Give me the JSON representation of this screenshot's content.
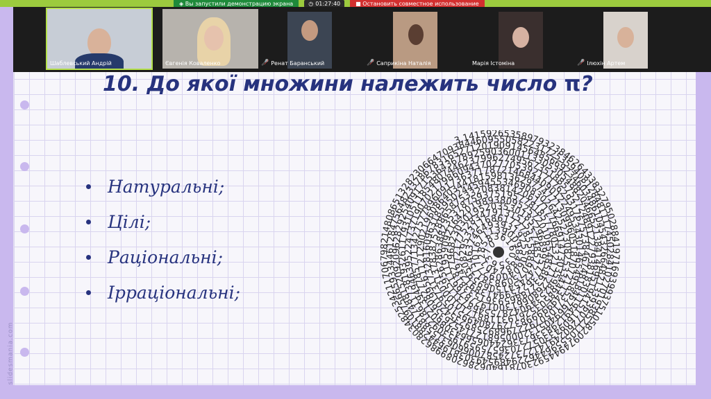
{
  "screen_share": {
    "status_text": "Вы запустили демонстрацию экрана",
    "timer": "01:27:40",
    "stop_label": "Остановить совместное использование"
  },
  "participants": [
    {
      "name": "Шаблевський Андрій",
      "muted": false,
      "active": true
    },
    {
      "name": "Євгенія Коваленко",
      "muted": false,
      "active": false
    },
    {
      "name": "Ренат Баранський",
      "muted": true,
      "active": false
    },
    {
      "name": "Саприкіна Наталія",
      "muted": true,
      "active": false
    },
    {
      "name": "Марія Істоміна",
      "muted": false,
      "active": false
    },
    {
      "name": "Ілюхін Артем",
      "muted": true,
      "active": false
    }
  ],
  "slide": {
    "title": "10. До якої множини належить число",
    "title_symbol": "π",
    "title_end": "?",
    "options": [
      "Натуральні;",
      "Цілі;",
      "Раціональні;",
      "Ірраціональні;"
    ],
    "watermark": "slidesmania.com",
    "pi_digits": "3,14159265358979323846264338327950288419716939937510582097494459230781640628620899862803482534211706798214808651328230664709384460955058223172535940812848111745028410270193852110555964462294895493038196442881097566593344612847564823378678316527120190914564856692346034861045432664821339360726024914127372458700660631558817488152092096282925409171536436789259036001133053054882046652138414695194151160943305727036575959195309218611738193261179310511854807446237996274956735188575272489122793818301194912983367336244065664308602139494639522473719070217986094370277053921717629317675238467481846766940513200056812714526356082778577134275778960917363717872146844090122495343014654958537105079227968925892354201995611212902196086403441815981362977477130996051870721134999999837297804995105973173281609631859502445945534690830264252230825334468503526193118817101000313783875288658753320838142061717766914730359825349042875546873115956286388235378759375195778185778053217122680661300192787661119590921642019893809525720106548586327886593615338182796823030195203530185296899577362259941389124972177528347913151557485724245415069595082953311686172785588907509838175463746493931925506040092770167113900984882401285836160356370766010471018194295559619894676783744944825537977472684710404753464620804668425906949129331367702898915210475216205696602405803815019351125338243003558764024749647326391419927260426992279678235478163600934172164121992458631503028618297455570674983850549458858692699569092721079750930295532116534498720275596023648066549911988183479775356636980742654252786255181841757467289097777279380008164706001614524919217321721477235014144197356854816136115735255213347574184946843852332390739414333454776241686251898356948556209921922218427255025425688767179049460165346680498862723279178608578438382796797668145410095388378636095068006422512520511739298489608412848862694560424196528502221066118630674427862203919494504712371378696095636437191728746776465757396241389086583264599581339047802759009946576407895126946839835259570982582262052248940772671947826848260147699090264013639443745530506820349625245174939965143142980919065925093722169646151570985838741059788595977297549893016175392846813826868386894277415599185592524595395943104997252468084598727364469584865383673622262609912460805124388439045124413654976278079771569143599770012961608944169486855584840635342207222582848864815845602850601684273945226746767889525213852254995466672782398645659611635488623057745649803559363456817432411251507606947945109659609402522887971089314566913686722874894056010150330861792868092087476091782493858900971490967598526136554978189312978482168299894872265880485756401427047755513237964145152374623436454285844479526586782105114135473573952311342716610213596953623144295248493718711014576540359027993440374200731057853906219838744780847848968332144571386875194350643021845319104848100537061468067491927819119793995206141966342875444064374512371819217999839101591956181467514269123974894090718649423196"
  },
  "icons": {
    "mic_off": "mic-off-icon",
    "shield": "shield-icon",
    "clock": "clock-icon",
    "stop": "stop-icon"
  },
  "colors": {
    "accent_green": "#9ccb3e",
    "slide_text": "#27337e",
    "background_lilac": "#c9b8ee",
    "stop_red": "#d32f2f"
  }
}
